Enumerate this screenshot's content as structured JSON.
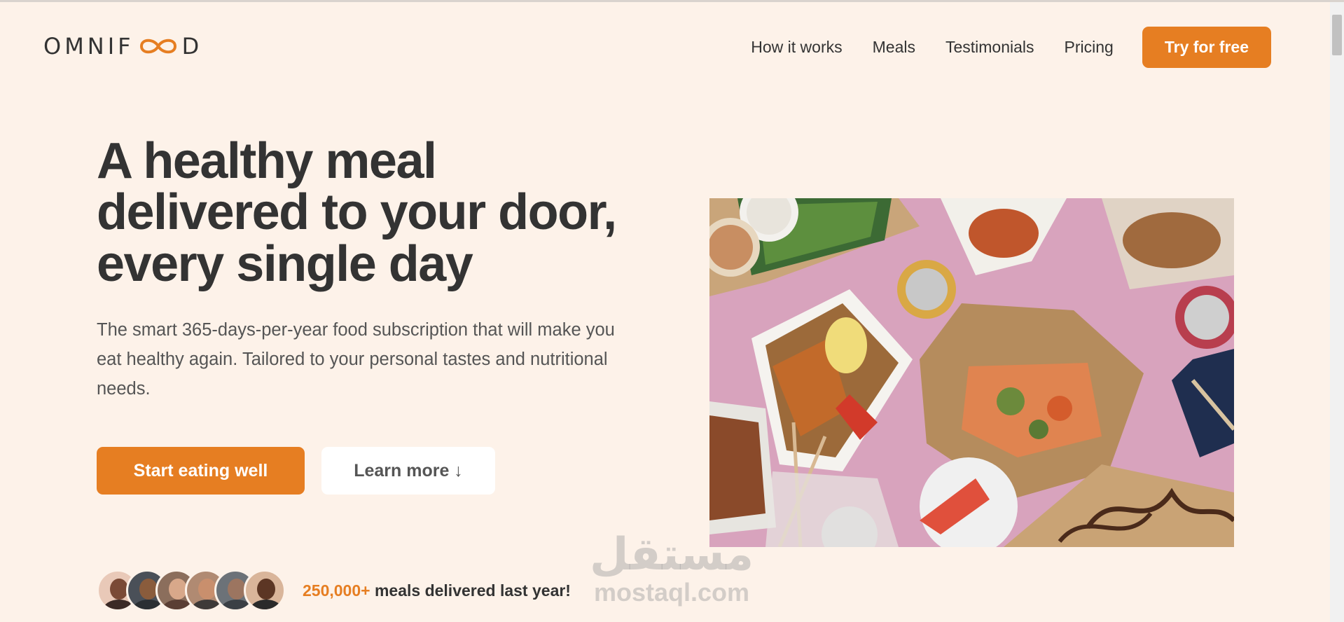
{
  "header": {
    "logo_left": "OMNIF",
    "logo_right": "D",
    "nav": [
      {
        "label": "How it works"
      },
      {
        "label": "Meals"
      },
      {
        "label": "Testimonials"
      },
      {
        "label": "Pricing"
      }
    ],
    "cta_label": "Try for free"
  },
  "hero": {
    "title": "A healthy meal delivered to your door, every single day",
    "description": "The smart 365-days-per-year food subscription that will make you eat healthy again. Tailored to your personal tastes and nutritional needs.",
    "primary_button": "Start eating well",
    "secondary_button": "Learn more ↓",
    "delivered_count": "250,000+",
    "delivered_text": " meals delivered last year!"
  },
  "watermark": {
    "arabic": "مستقل",
    "latin": "mostaql.com"
  },
  "colors": {
    "background": "#fdf2e9",
    "accent": "#e67e22",
    "text": "#333333"
  },
  "icons": {
    "logo_mark": "infinity-icon",
    "image": "food-photo"
  }
}
